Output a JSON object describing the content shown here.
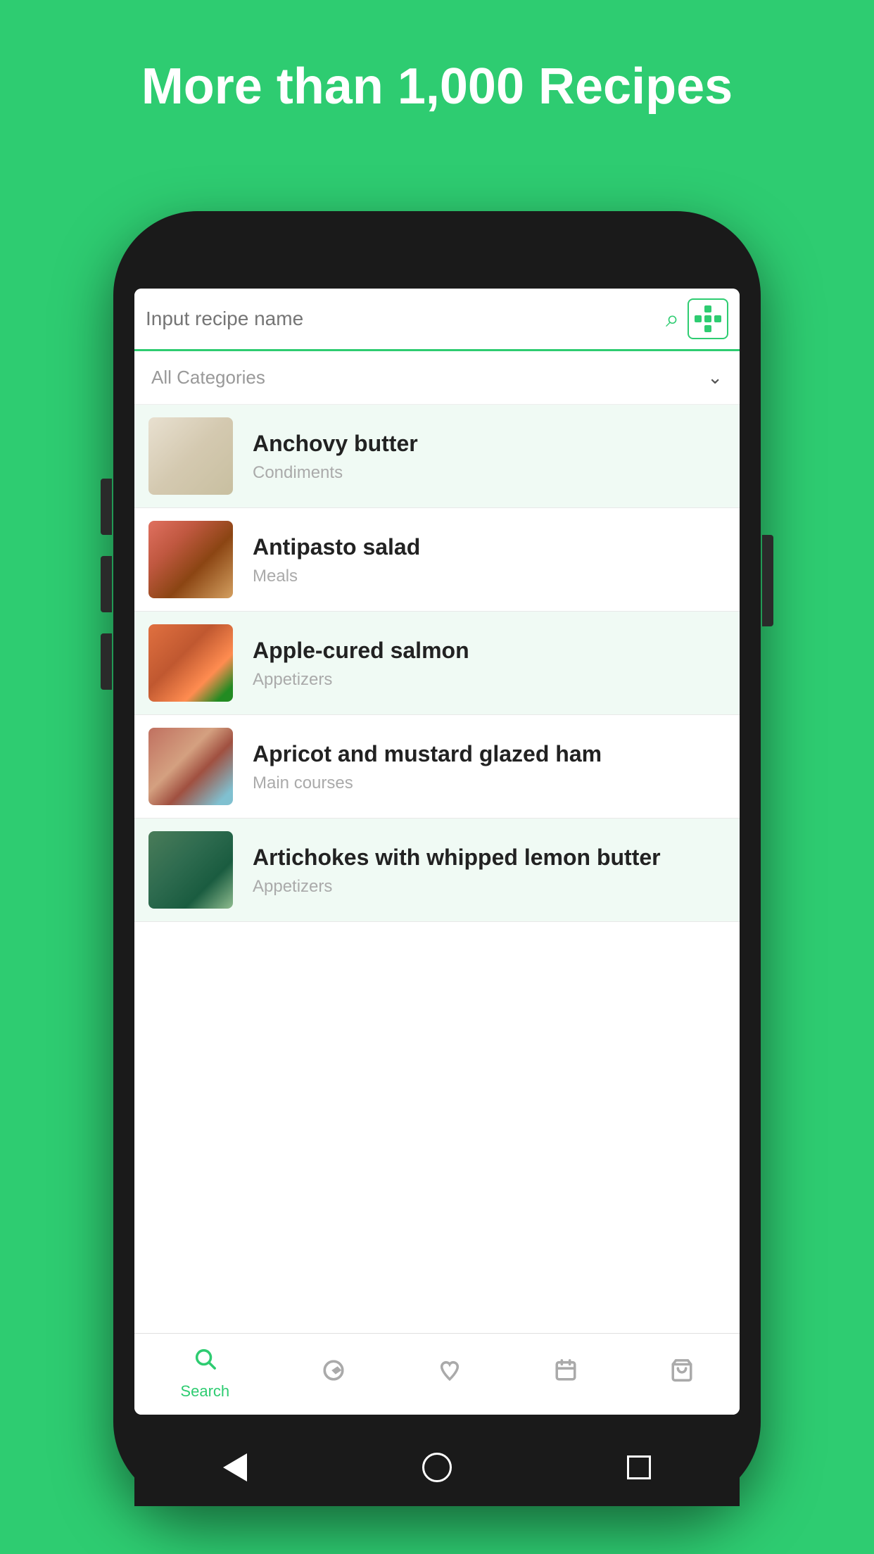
{
  "header": {
    "title": "More than 1,000 Recipes"
  },
  "search": {
    "placeholder": "Input recipe name",
    "icon": "search-icon",
    "grid_icon": "grid-icon"
  },
  "filter": {
    "label": "All Categories",
    "chevron": "▾"
  },
  "recipes": [
    {
      "id": 1,
      "name": "Anchovy butter",
      "category": "Condiments",
      "shaded": true,
      "food_class": "food-anchovy"
    },
    {
      "id": 2,
      "name": "Antipasto salad",
      "category": "Meals",
      "shaded": false,
      "food_class": "food-antipasto"
    },
    {
      "id": 3,
      "name": "Apple-cured salmon",
      "category": "Appetizers",
      "shaded": true,
      "food_class": "food-salmon"
    },
    {
      "id": 4,
      "name": "Apricot and mustard glazed ham",
      "category": "Main courses",
      "shaded": false,
      "food_class": "food-ham"
    },
    {
      "id": 5,
      "name": "Artichokes with whipped lemon butter",
      "category": "Appetizers",
      "shaded": true,
      "food_class": "food-artichoke"
    }
  ],
  "bottom_nav": [
    {
      "id": "search",
      "label": "Search",
      "icon": "🔍",
      "active": true
    },
    {
      "id": "explore",
      "label": "",
      "icon": "🧭",
      "active": false
    },
    {
      "id": "favorites",
      "label": "",
      "icon": "♡",
      "active": false
    },
    {
      "id": "calendar",
      "label": "",
      "icon": "📅",
      "active": false
    },
    {
      "id": "cart",
      "label": "",
      "icon": "🛒",
      "active": false
    }
  ],
  "colors": {
    "brand_green": "#2ecc71",
    "active_green": "#2ecc71",
    "inactive_gray": "#aaaaaa",
    "background": "#2ecc71"
  }
}
